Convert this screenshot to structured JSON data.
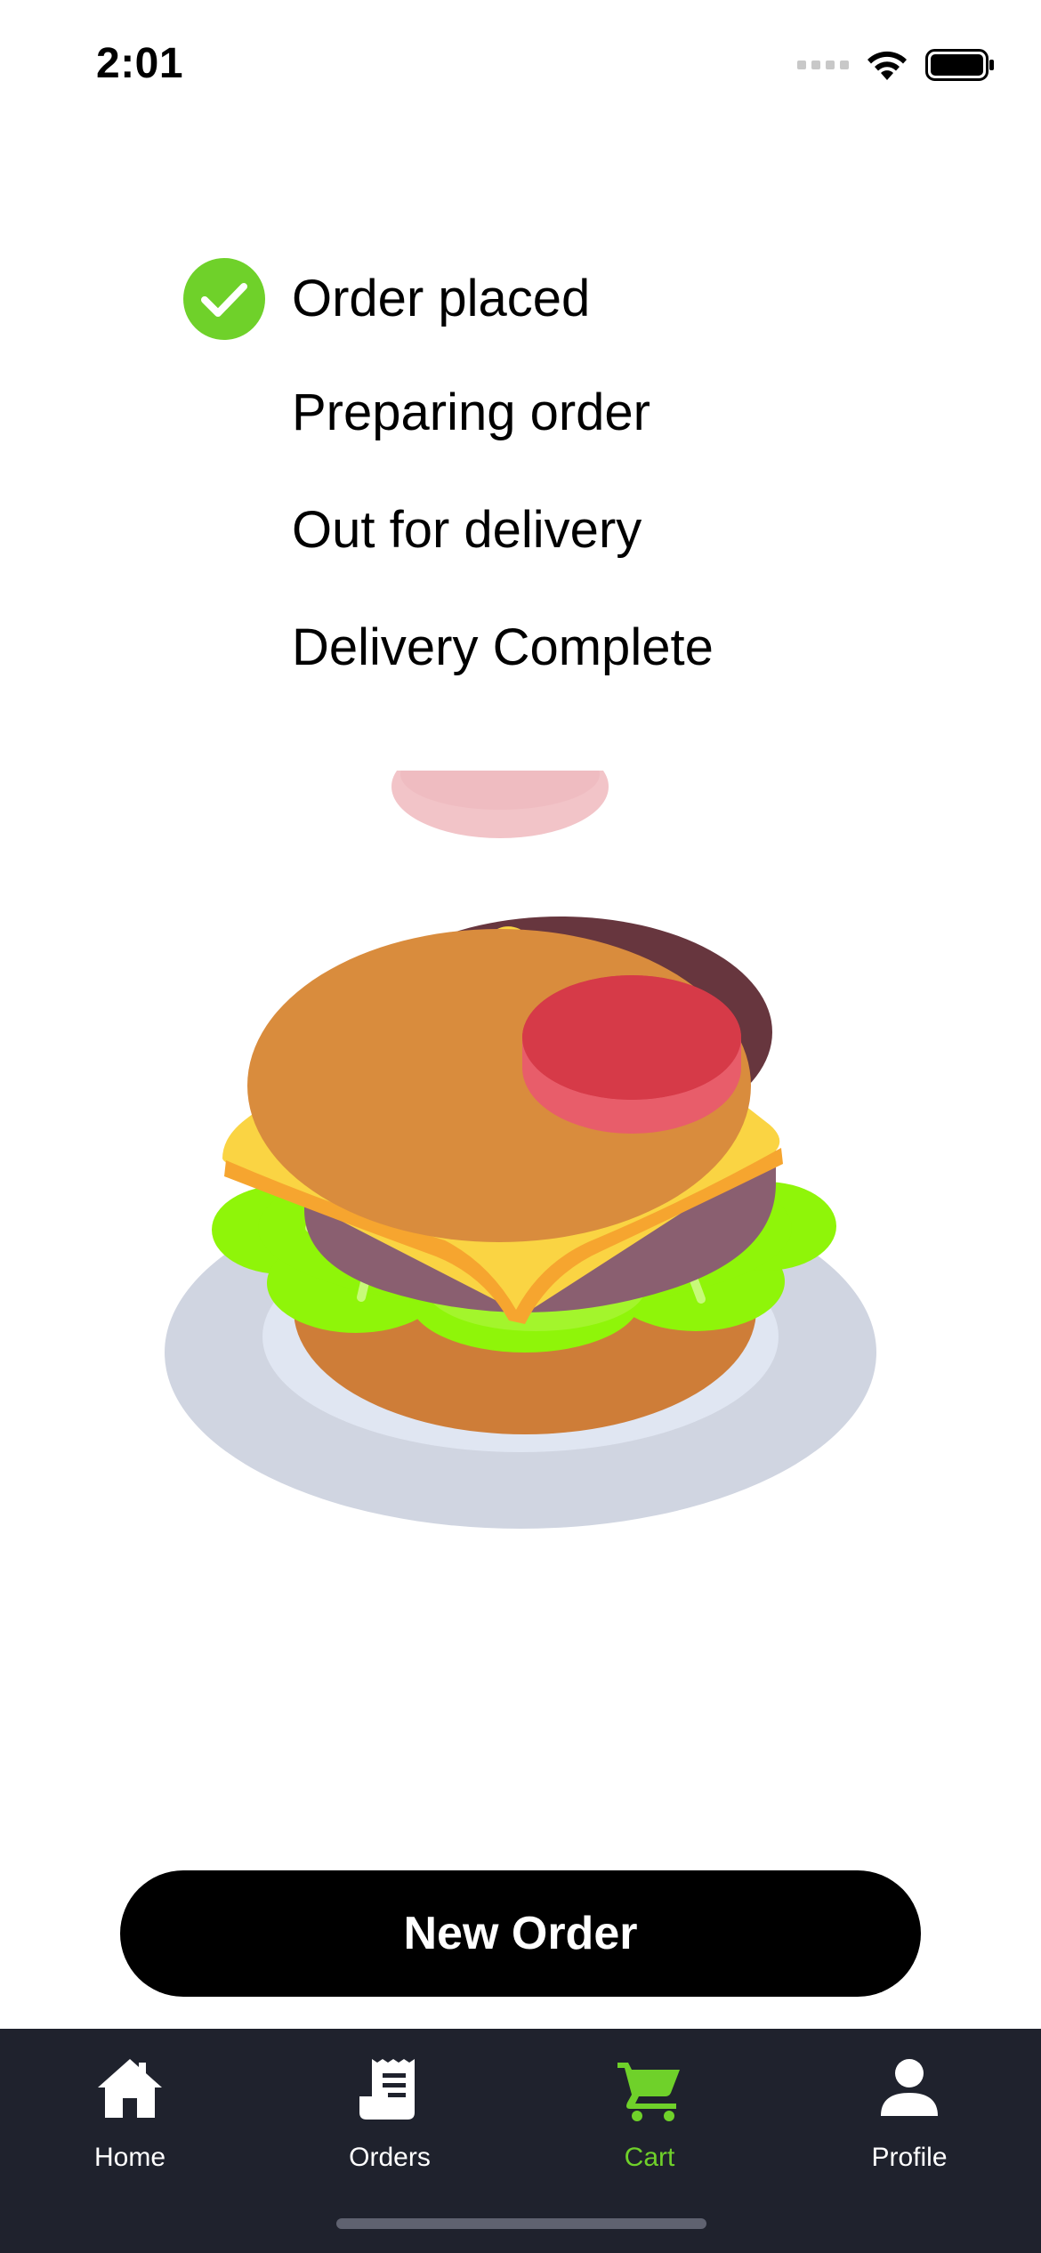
{
  "status_bar": {
    "time": "2:01"
  },
  "order_progress": {
    "steps": [
      {
        "label": "Order placed",
        "completed": true
      },
      {
        "label": "Preparing order",
        "completed": false
      },
      {
        "label": "Out for delivery",
        "completed": false
      },
      {
        "label": "Delivery Complete",
        "completed": false
      }
    ],
    "check_color": "#6fd12a"
  },
  "illustration": {
    "icon": "burger-illustration"
  },
  "actions": {
    "new_order_label": "New Order"
  },
  "tab_bar": {
    "active_color": "#6fd12a",
    "background": "#1f222d",
    "tabs": [
      {
        "label": "Home",
        "icon": "home-icon",
        "active": false
      },
      {
        "label": "Orders",
        "icon": "receipt-icon",
        "active": false
      },
      {
        "label": "Cart",
        "icon": "cart-icon",
        "active": true
      },
      {
        "label": "Profile",
        "icon": "person-icon",
        "active": false
      }
    ]
  }
}
